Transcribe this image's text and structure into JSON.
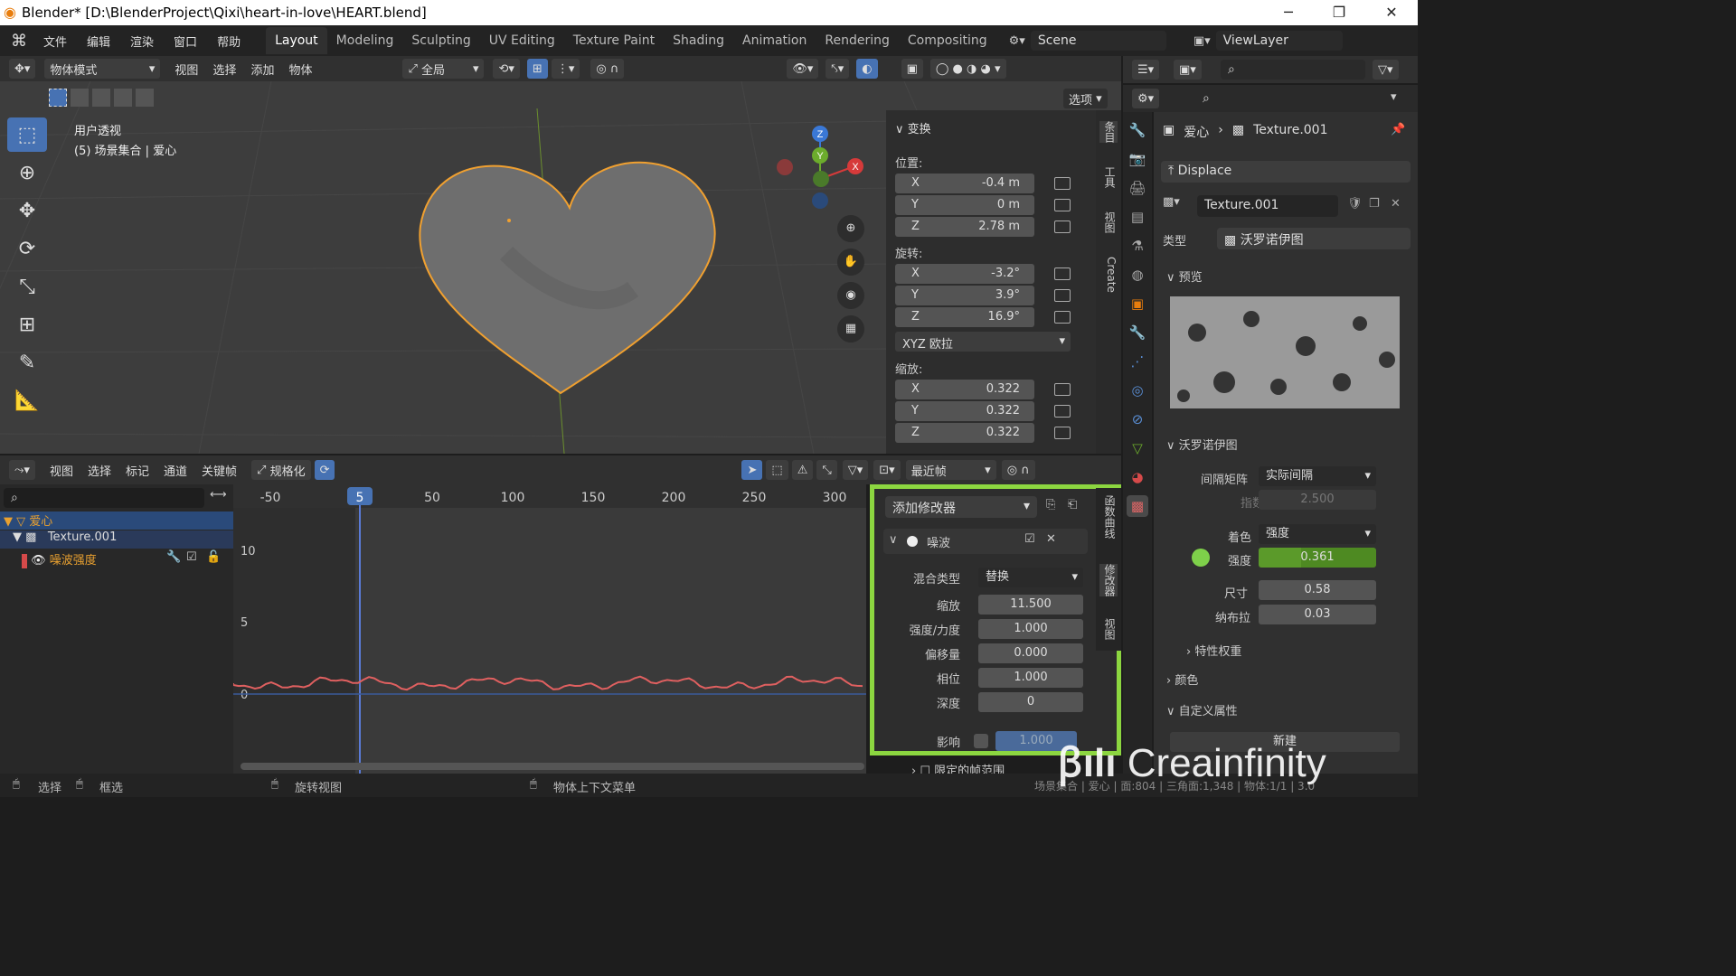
{
  "window": {
    "title": "Blender* [D:\\BlenderProject\\Qixi\\heart-in-love\\HEART.blend]",
    "minimize": "─",
    "maximize": "❐",
    "close": "✕"
  },
  "menu": [
    "文件",
    "编辑",
    "渲染",
    "窗口",
    "帮助"
  ],
  "workspaces": [
    "Layout",
    "Modeling",
    "Sculpting",
    "UV Editing",
    "Texture Paint",
    "Shading",
    "Animation",
    "Rendering",
    "Compositing"
  ],
  "scene": "Scene",
  "view_layer": "ViewLayer",
  "vp_header": {
    "mode": "物体模式",
    "menus": [
      "视图",
      "选择",
      "添加",
      "物体"
    ],
    "orientation": "全局",
    "options": "选项"
  },
  "viewport": {
    "view_name": "用户透视",
    "collection": "(5) 场景集合 | 爱心",
    "axes": {
      "x": "X",
      "y": "Y",
      "z": "Z"
    }
  },
  "npanel": {
    "section": "变换",
    "location_label": "位置:",
    "location": [
      {
        "axis": "X",
        "value": "-0.4 m"
      },
      {
        "axis": "Y",
        "value": "0 m"
      },
      {
        "axis": "Z",
        "value": "2.78 m"
      }
    ],
    "rotation_label": "旋转:",
    "rotation": [
      {
        "axis": "X",
        "value": "-3.2°"
      },
      {
        "axis": "Y",
        "value": "3.9°"
      },
      {
        "axis": "Z",
        "value": "16.9°"
      }
    ],
    "rotation_mode": "XYZ 欧拉",
    "scale_label": "缩放:",
    "scale": [
      {
        "axis": "X",
        "value": "0.322"
      },
      {
        "axis": "Y",
        "value": "0.322"
      },
      {
        "axis": "Z",
        "value": "0.322"
      }
    ],
    "tabs": [
      "条目",
      "工具",
      "视图",
      "Create"
    ]
  },
  "props": {
    "breadcrumb_obj": "爱心",
    "breadcrumb_tex": "Texture.001",
    "modifier": "Displace",
    "texture_name": "Texture.001",
    "type_label": "类型",
    "type_value": "沃罗诺伊图",
    "preview_label": "预览",
    "voronoi_label": "沃罗诺伊图",
    "distance_label": "间隔矩阵",
    "distance_value": "实际间隔",
    "exponent_label": "指数",
    "exponent_value": "2.500",
    "coloring_label": "着色",
    "coloring_value": "强度",
    "intensity_label": "强度",
    "intensity_value": "0.361",
    "size_label": "尺寸",
    "size_value": "0.58",
    "nabla_label": "纳布拉",
    "nabla_value": "0.03",
    "feature_weights": "特性权重",
    "colors": "颜色",
    "custom_props": "自定义属性",
    "new_btn": "新建",
    "intensity_fill": 0.361
  },
  "graph_header": {
    "menus": [
      "视图",
      "选择",
      "标记",
      "通道",
      "关键帧"
    ],
    "normalize": "规格化",
    "nearest": "最近帧"
  },
  "graph": {
    "current_frame": "5",
    "frame_ticks": [
      "-50",
      "50",
      "100",
      "150",
      "200",
      "250",
      "300"
    ],
    "value_ticks": [
      "10",
      "5",
      "0"
    ]
  },
  "outliner": {
    "items": [
      "爱心",
      "Texture.001",
      "噪波强度"
    ]
  },
  "modifiers": {
    "add_label": "添加修改器",
    "name": "噪波",
    "rows": [
      {
        "label": "混合类型",
        "value": "替换"
      },
      {
        "label": "缩放",
        "value": "11.500"
      },
      {
        "label": "强度/力度",
        "value": "1.000"
      },
      {
        "label": "偏移量",
        "value": "0.000"
      },
      {
        "label": "相位",
        "value": "1.000"
      },
      {
        "label": "深度",
        "value": "0"
      }
    ],
    "influence_label": "影响",
    "influence_value": "1.000",
    "restrict": "限定的帧范围",
    "side_tabs": [
      "函数曲线",
      "修改器",
      "视图"
    ]
  },
  "status": {
    "select": "选择",
    "box": "框选",
    "rotate": "旋转视图",
    "context": "物体上下文菜单",
    "stats": "场景集合 | 爱心 | 面:804 | 三角面:1,348 | 物体:1/1 | 3.0"
  },
  "watermark": "Creainfinity"
}
